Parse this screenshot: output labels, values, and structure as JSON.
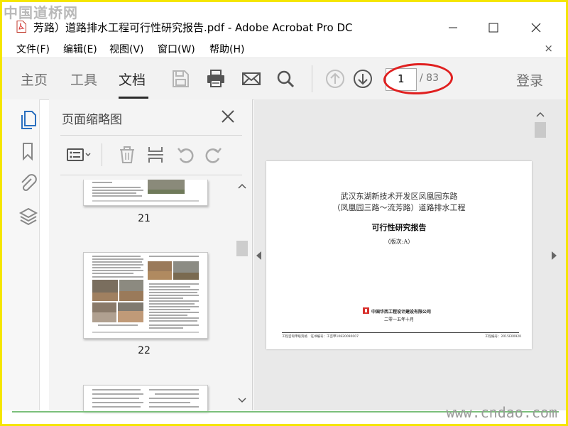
{
  "watermark": {
    "top": "中国道桥网",
    "bottom": "www.cndao.com"
  },
  "window": {
    "title": "芳路）道路排水工程可行性研究报告.pdf - Adobe Acrobat Pro DC"
  },
  "menu": {
    "items": [
      "文件(F)",
      "编辑(E)",
      "视图(V)",
      "窗口(W)",
      "帮助(H)"
    ],
    "close_doc": "×"
  },
  "toolbar": {
    "tabs": [
      "主页",
      "工具",
      "文档"
    ],
    "active_tab": "文档",
    "page_current": "1",
    "page_total": "/ 83",
    "login": "登录"
  },
  "panel": {
    "title": "页面缩略图",
    "thumbnails": [
      {
        "label": "21"
      },
      {
        "label": "22"
      }
    ]
  },
  "document": {
    "line1": "武汉东湖新技术开发区凤凰园东路",
    "line2": "（凤凰园三路～流芳路）道路排水工程",
    "heading": "可行性研究报告",
    "version": "（版次:A）",
    "company": "中国华西工程设计建设有限公司",
    "date": "二零一五年十月",
    "footer_left": "工程咨询甲级资格　证书编号：工咨甲10820090007",
    "footer_right": "工程编号：2015E0092K"
  },
  "colors": {
    "highlight": "#e02020",
    "accent": "#2a6fbf",
    "frame": "#f5e600"
  }
}
